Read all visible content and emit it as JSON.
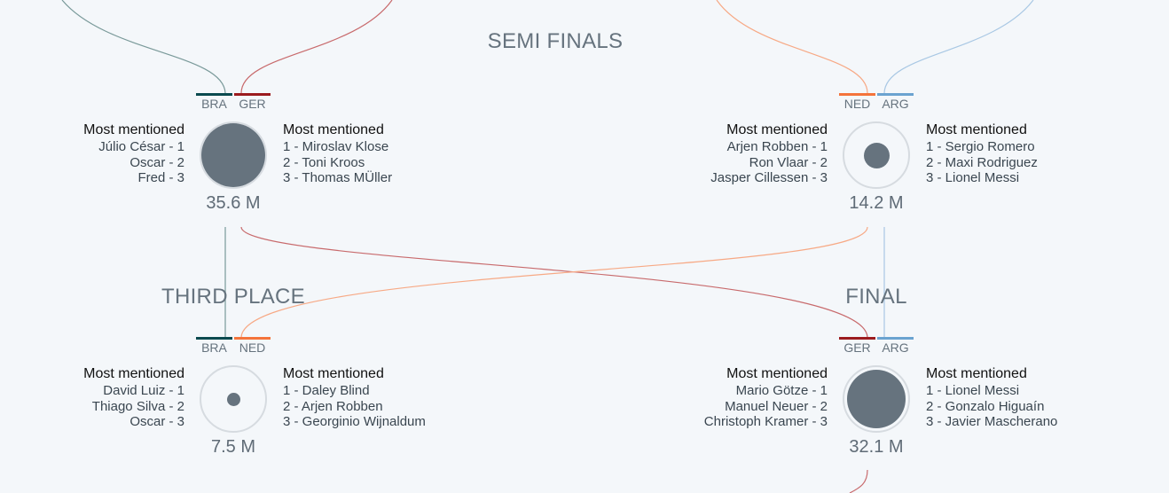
{
  "colors": {
    "BRA": "#0b4a4f",
    "GER": "#9b1b1e",
    "NED": "#f4743b",
    "ARG": "#6ba3d0",
    "bubble": "#66737e",
    "ring": "#d6dbe0"
  },
  "rounds": {
    "semi": "SEMI FINALS",
    "third": "THIRD PLACE",
    "final": "FINAL"
  },
  "matches": [
    {
      "team1": "BRA",
      "team2": "GER",
      "total": "35.6 M",
      "volume_ratio": 1.0,
      "header1": "Most mentioned",
      "header2": "Most mentioned",
      "players1": [
        "Júlio César - 1",
        "Oscar - 2",
        "Fred - 3"
      ],
      "players2": [
        "1 - Miroslav Klose",
        "2 - Toni Kroos",
        "3 - Thomas MÜller"
      ]
    },
    {
      "team1": "NED",
      "team2": "ARG",
      "total": "14.2 M",
      "volume_ratio": 0.4,
      "header1": "Most mentioned",
      "header2": "Most mentioned",
      "players1": [
        "Arjen Robben - 1",
        "Ron Vlaar - 2",
        "Jasper Cillessen - 3"
      ],
      "players2": [
        "1 - Sergio Romero",
        "2 - Maxi Rodriguez",
        "3 - Lionel Messi"
      ]
    },
    {
      "team1": "BRA",
      "team2": "NED",
      "total": "7.5 M",
      "volume_ratio": 0.21,
      "header1": "Most mentioned",
      "header2": "Most mentioned",
      "players1": [
        "David Luiz - 1",
        "Thiago Silva - 2",
        "Oscar - 3"
      ],
      "players2": [
        "1 - Daley Blind",
        "2 - Arjen Robben",
        "3 - Georginio Wijnaldum"
      ]
    },
    {
      "team1": "GER",
      "team2": "ARG",
      "total": "32.1 M",
      "volume_ratio": 0.9,
      "header1": "Most mentioned",
      "header2": "Most mentioned",
      "players1": [
        "Mario Götze - 1",
        "Manuel Neuer - 2",
        "Christoph Kramer - 3"
      ],
      "players2": [
        "1 - Lionel Messi",
        "2 - Gonzalo Higuaín",
        "3 - Javier Mascherano"
      ]
    }
  ]
}
